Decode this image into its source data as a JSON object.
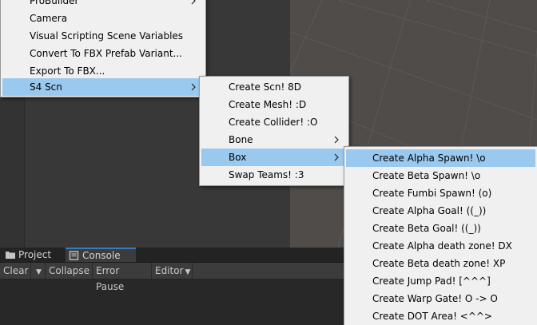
{
  "tabs": {
    "project": "Project",
    "console": "Console"
  },
  "console_toolbar": {
    "clear": "Clear",
    "collapse": "Collapse",
    "error_pause": "Error Pause",
    "editor": "Editor"
  },
  "main_menu": {
    "items": [
      {
        "label": "ProBuilder"
      },
      {
        "label": "Camera"
      },
      {
        "label": "Visual Scripting Scene Variables"
      },
      {
        "label": "Convert To FBX Prefab Variant..."
      },
      {
        "label": "Export To FBX..."
      },
      {
        "label": "S4 Scn"
      }
    ]
  },
  "s4_menu": {
    "items": [
      {
        "label": "Create Scn! 8D"
      },
      {
        "label": "Create Mesh! :D"
      },
      {
        "label": "Create Collider! :O"
      },
      {
        "label": "Bone"
      },
      {
        "label": "Box"
      },
      {
        "label": "Swap Teams! :3"
      }
    ]
  },
  "box_menu": {
    "items": [
      {
        "label": "Create Alpha Spawn! \\o"
      },
      {
        "label": "Create Beta Spawn! \\o"
      },
      {
        "label": "Create Fumbi Spawn! (o)"
      },
      {
        "label": "Create Alpha Goal! ((_))"
      },
      {
        "label": "Create Beta Goal! ((_))"
      },
      {
        "label": "Create Alpha death zone! DX"
      },
      {
        "label": "Create Beta death zone! XP"
      },
      {
        "label": "Create Jump Pad! [^^^]"
      },
      {
        "label": "Create Warp Gate! O -> O"
      },
      {
        "label": "Create DOT Area! <^^>"
      }
    ]
  },
  "colors": {
    "menu_bg": "#f0f0f0",
    "highlight": "#99c9ef",
    "console_tab_accent": "#3a79bb"
  }
}
